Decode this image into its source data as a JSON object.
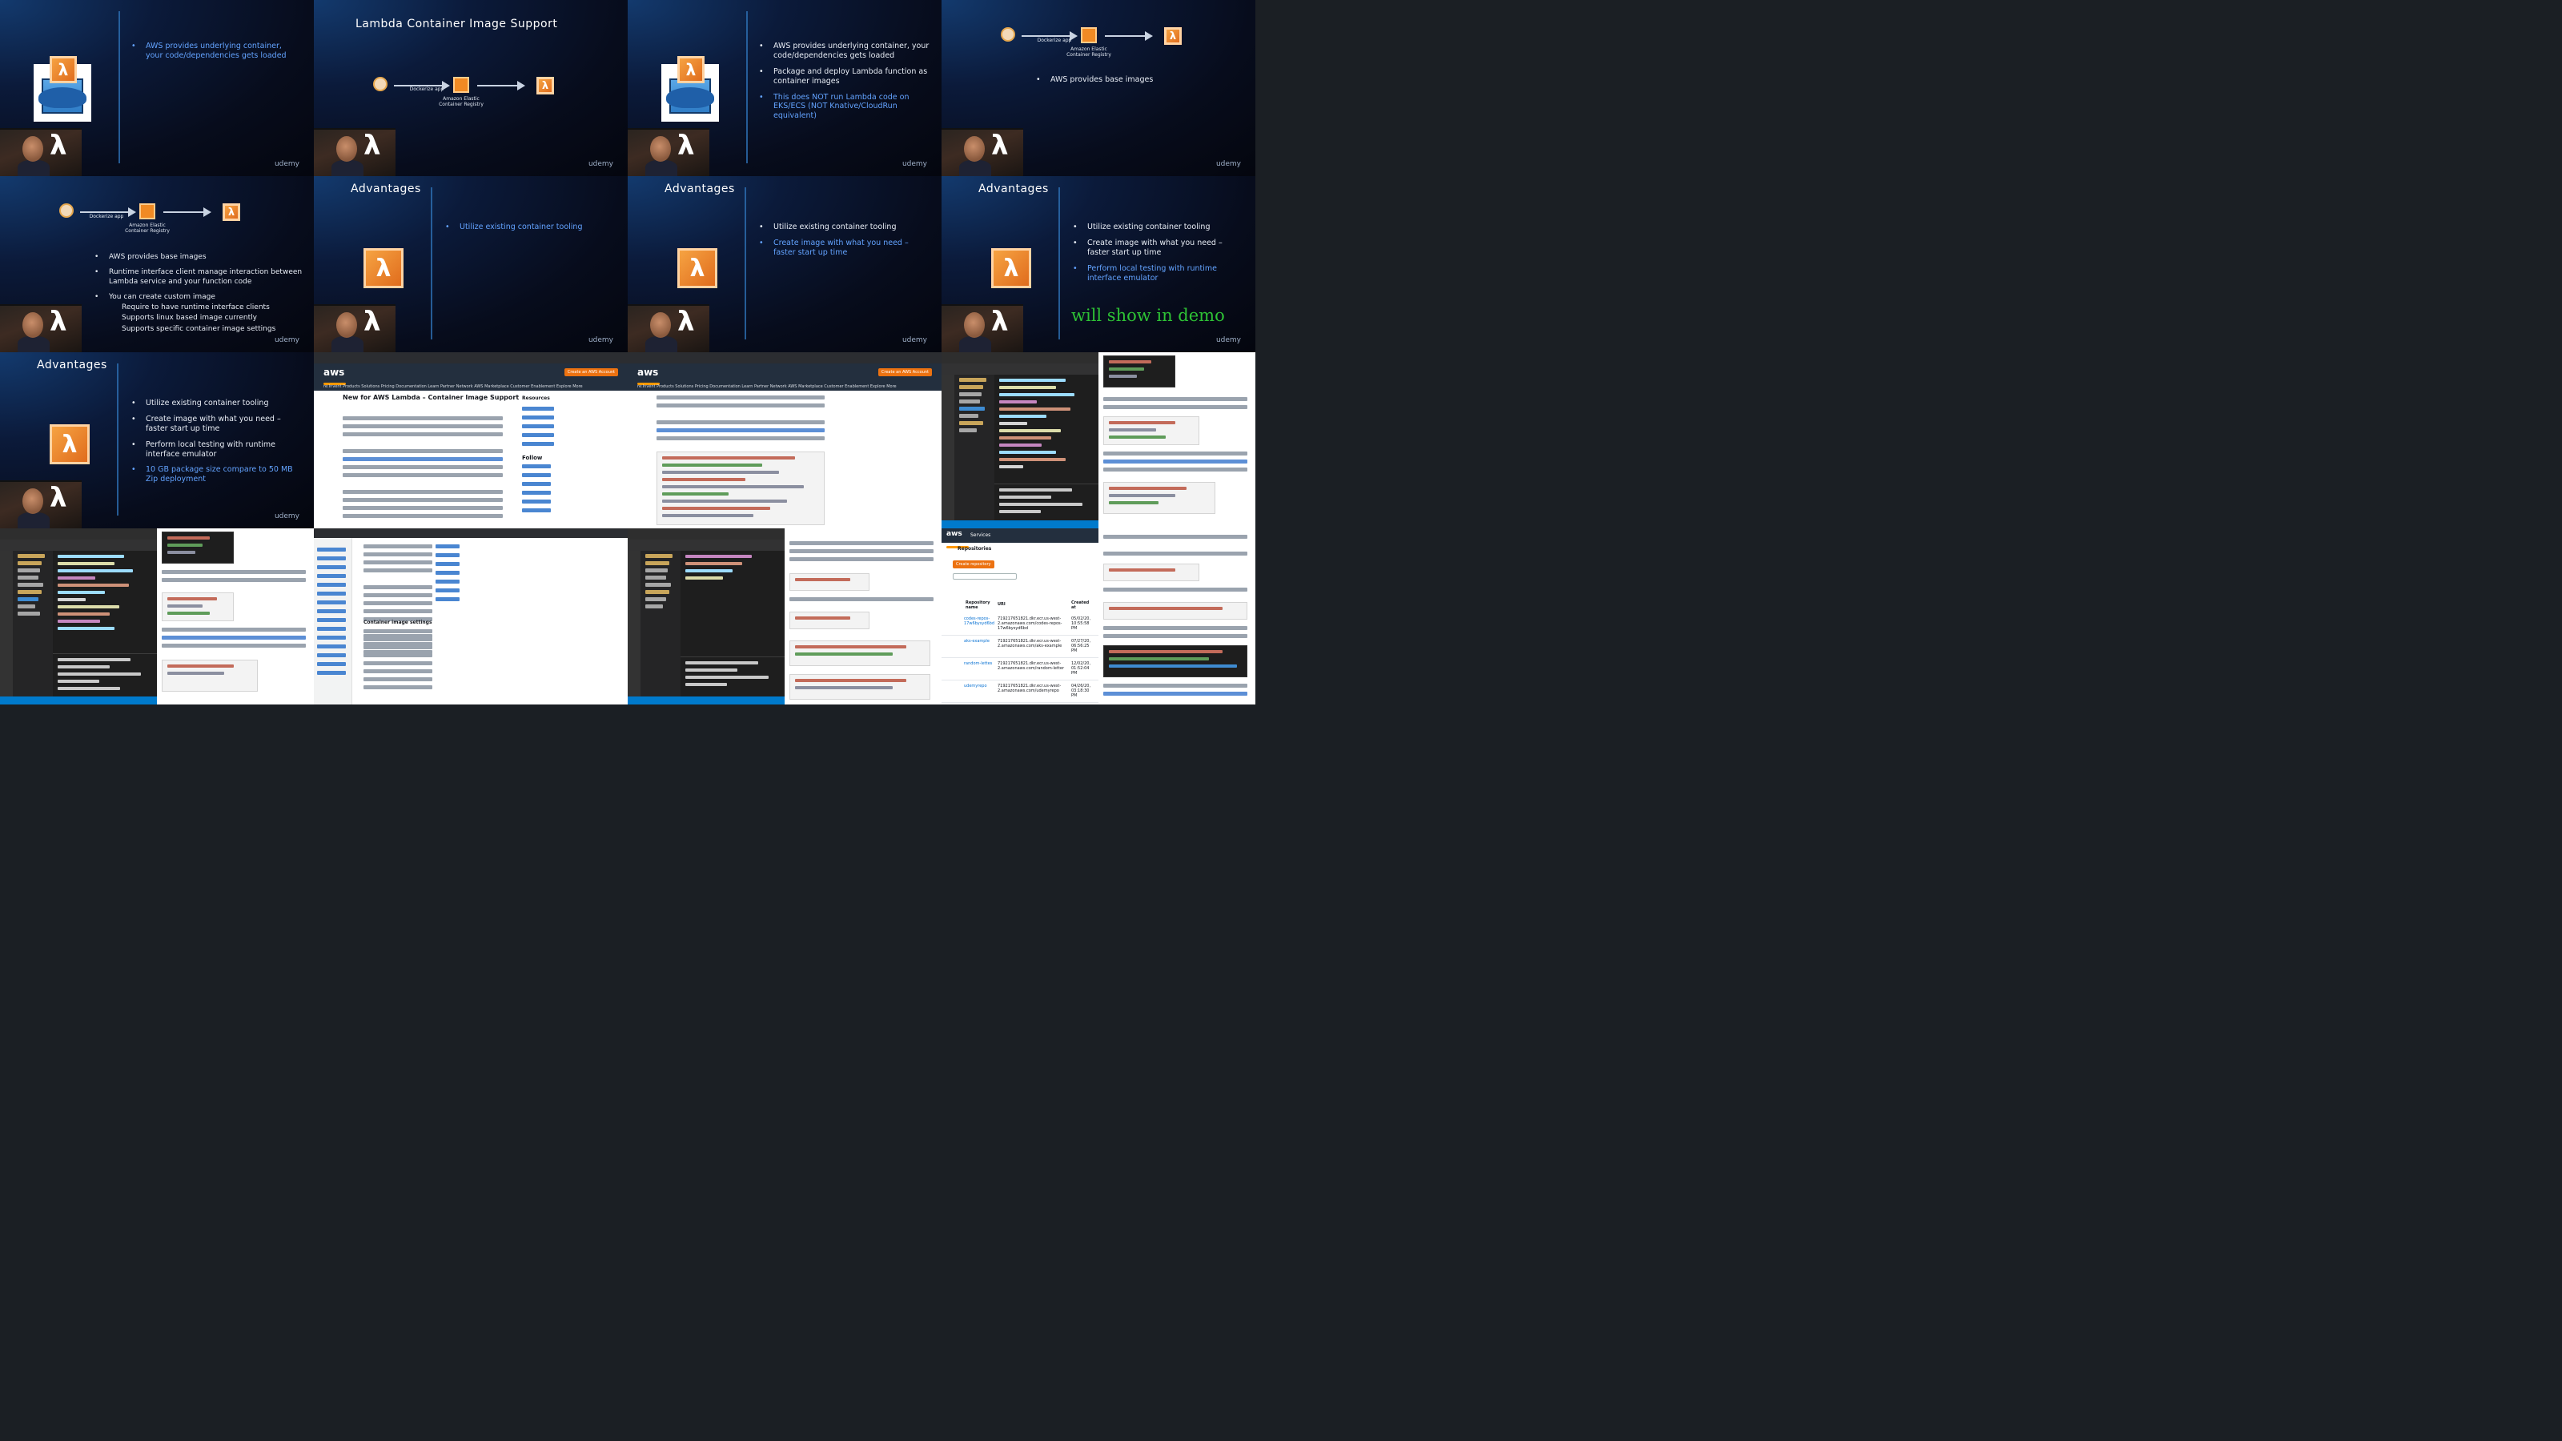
{
  "slides": {
    "s1": {
      "bullets": [
        "AWS provides underlying container, your code/dependencies gets loaded"
      ]
    },
    "s2": {
      "title": "Lambda Container Image Support",
      "flow_dockerize": "Dockerize app",
      "flow_ecr": "Amazon Elastic Container Registry"
    },
    "s3": {
      "bullets": [
        "AWS provides underlying container, your code/dependencies gets loaded",
        "Package and deploy Lambda function as container images",
        "This does NOT run Lambda code on EKS/ECS (NOT Knative/CloudRun equivalent)"
      ]
    },
    "s4": {
      "flow_dockerize": "Dockerize app",
      "flow_ecr": "Amazon Elastic Container Registry",
      "bullets": [
        "AWS provides base images"
      ]
    },
    "s5": {
      "flow_dockerize": "Dockerize app",
      "flow_ecr": "Amazon Elastic Container Registry",
      "bullets": [
        "AWS provides base images",
        "Runtime interface client manage interaction between Lambda service and your function code",
        "You can create custom image"
      ],
      "sub_bullets": [
        "Require to have runtime interface clients",
        "Supports linux based image currently",
        "Supports specific container image settings"
      ]
    },
    "s6": {
      "title": "Advantages",
      "bullets": [
        "Utilize existing container tooling"
      ]
    },
    "s7": {
      "title": "Advantages",
      "bullets": [
        "Utilize existing container tooling",
        "Create image with what you need – faster start up time"
      ]
    },
    "s8": {
      "title": "Advantages",
      "bullets": [
        "Utilize existing container tooling",
        "Create image with what you need – faster start up time",
        "Perform local testing with runtime interface emulator"
      ],
      "demo_note": "will show in demo"
    },
    "s9": {
      "title": "Advantages",
      "bullets": [
        "Utilize existing container tooling",
        "Create image with what you need – faster start up time",
        "Perform local testing with runtime interface emulator",
        "10 GB package size compare to 50 MB Zip deployment"
      ]
    },
    "corner": "udemy"
  },
  "blog": {
    "logo": "aws",
    "cta": "Create an AWS Account",
    "nav": "re:Invent   Products   Solutions   Pricing   Documentation   Learn   Partner Network   AWS Marketplace   Customer Enablement   Explore More",
    "heading": "New for AWS Lambda – Container Image Support",
    "resources": "Resources",
    "follow": "Follow",
    "section": "Container image settings"
  },
  "ecr_console": {
    "logo": "aws",
    "services": "Services",
    "repositories": "Repositories",
    "create_button": "Create repository",
    "col_name": "Repository name",
    "col_uri": "URI",
    "col_created": "Created at",
    "rows": [
      {
        "name": "codes-repos-17w6bysyd6bd",
        "uri": "719217651821.dkr.ecr.us-west-2.amazonaws.com/codes-repos-17w6bysyd6bd",
        "created": "05/02/20, 10:55:58 PM"
      },
      {
        "name": "aks-example",
        "uri": "719217651821.dkr.ecr.us-west-2.amazonaws.com/aks-example",
        "created": "07/27/20, 06:56:25 PM"
      },
      {
        "name": "random-lettes",
        "uri": "719217651821.dkr.ecr.us-west-2.amazonaws.com/random-letter",
        "created": "12/02/20, 01:52:04 PM"
      },
      {
        "name": "udemyrepo",
        "uri": "719217651821.dkr.ecr.us-west-2.amazonaws.com/udemyrepo",
        "created": "04/26/20, 03:18:30 PM"
      }
    ]
  },
  "colors": {
    "accent_blue": "#63a3ff",
    "aws_orange": "#ff9900",
    "lambda_orange": "#e06c1d",
    "demo_green": "#2ec235"
  }
}
